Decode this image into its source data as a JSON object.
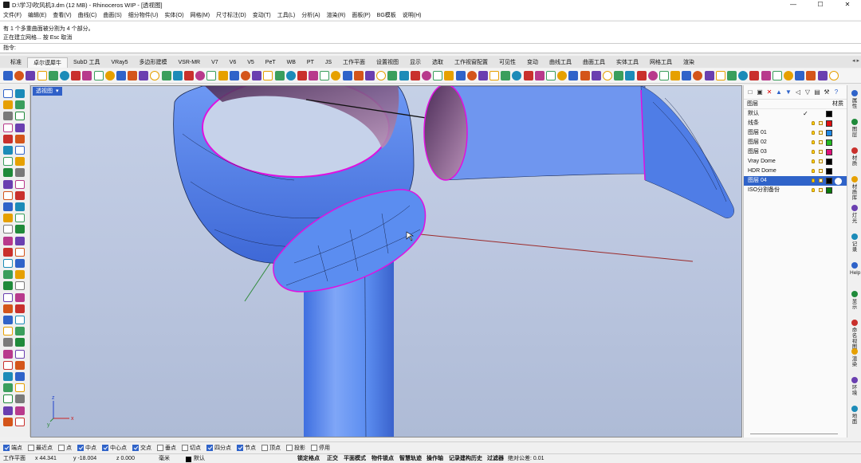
{
  "window": {
    "title": "D:\\学习\\吹风机3.dm (12 MB) - Rhinoceros WIP - [透视图]",
    "controls": [
      "—",
      "☐",
      "✕"
    ]
  },
  "menu": [
    "文件(F)",
    "编辑(E)",
    "查看(V)",
    "曲线(C)",
    "曲面(S)",
    "细分物件(U)",
    "实体(O)",
    "网格(M)",
    "尺寸标注(D)",
    "变动(T)",
    "工具(L)",
    "分析(A)",
    "渲染(R)",
    "面板(P)",
    "BG模板",
    "说明(H)"
  ],
  "command_history": [
    "有 1 个多重曲面被分割为 4 个部分。",
    "正在建立网格... 按 Esc 取消"
  ],
  "command_prompt": "指令:",
  "tabs": [
    "标准",
    "卓尔谟犀牛",
    "SubD 工具",
    "VRay5",
    "多边形建模",
    "VSR-MR",
    "V7",
    "V6",
    "V5",
    "PeT",
    "WB",
    "PT",
    "JS",
    "工作平面",
    "设置视图",
    "显示",
    "选取",
    "工作视窗配置",
    "可见性",
    "变动",
    "曲线工具",
    "曲面工具",
    "实体工具",
    "网格工具",
    "渲染"
  ],
  "active_tab": "卓尔谟犀牛",
  "viewport": {
    "label": "透视图",
    "label_arrow": "▾",
    "axis_labels": {
      "x": "x",
      "y": "y",
      "z": "z"
    }
  },
  "layers_panel": {
    "header": {
      "left": "图层",
      "right": "材质"
    },
    "layers": [
      {
        "name": "默认",
        "color": "#000000",
        "current": true,
        "selected": false
      },
      {
        "name": "线条",
        "color": "#e01010",
        "current": false,
        "selected": false
      },
      {
        "name": "图层 01",
        "color": "#1e88e5",
        "current": false,
        "selected": false
      },
      {
        "name": "图层 02",
        "color": "#22bb22",
        "current": false,
        "selected": false
      },
      {
        "name": "图层 03",
        "color": "#e0107a",
        "current": false,
        "selected": false
      },
      {
        "name": "Vray Dome",
        "color": "#000000",
        "current": false,
        "selected": false
      },
      {
        "name": "HDR Dome",
        "color": "#000000",
        "current": false,
        "selected": false
      },
      {
        "name": "图层 04",
        "color": "#000000",
        "current": false,
        "selected": true
      },
      {
        "name": "ISO分割备份",
        "color": "#0a7a0a",
        "current": false,
        "selected": false
      }
    ]
  },
  "side_tabs": [
    "属性",
    "图层",
    "材质",
    "材质库",
    "灯光",
    "记录",
    "Help",
    "显示",
    "命名视图",
    "渲染",
    "环境",
    "地面"
  ],
  "osnaps": [
    {
      "label": "端点",
      "on": true
    },
    {
      "label": "最近点",
      "on": false
    },
    {
      "label": "点",
      "on": false
    },
    {
      "label": "中点",
      "on": true
    },
    {
      "label": "中心点",
      "on": true
    },
    {
      "label": "交点",
      "on": true
    },
    {
      "label": "垂点",
      "on": false
    },
    {
      "label": "切点",
      "on": false
    },
    {
      "label": "四分点",
      "on": true
    },
    {
      "label": "节点",
      "on": true
    },
    {
      "label": "顶点",
      "on": false
    },
    {
      "label": "投影",
      "on": false
    },
    {
      "label": "停用",
      "on": false
    }
  ],
  "status": {
    "cplane": "工作平面",
    "x": "x 44.341",
    "y": "y -18.004",
    "z": "z 0.000",
    "units": "毫米",
    "layer": "默认",
    "toggles": [
      "锁定格点",
      "正交",
      "平面模式",
      "物件锁点",
      "智慧轨迹",
      "操作轴",
      "记录建构历史",
      "过滤器"
    ],
    "tolerance": "绝对公差: 0.01"
  },
  "colors": {
    "accent": "#2f63c9",
    "surface": "#5b8df0",
    "edge": "#e010e0",
    "viewport_bg": "#bfcae2"
  }
}
